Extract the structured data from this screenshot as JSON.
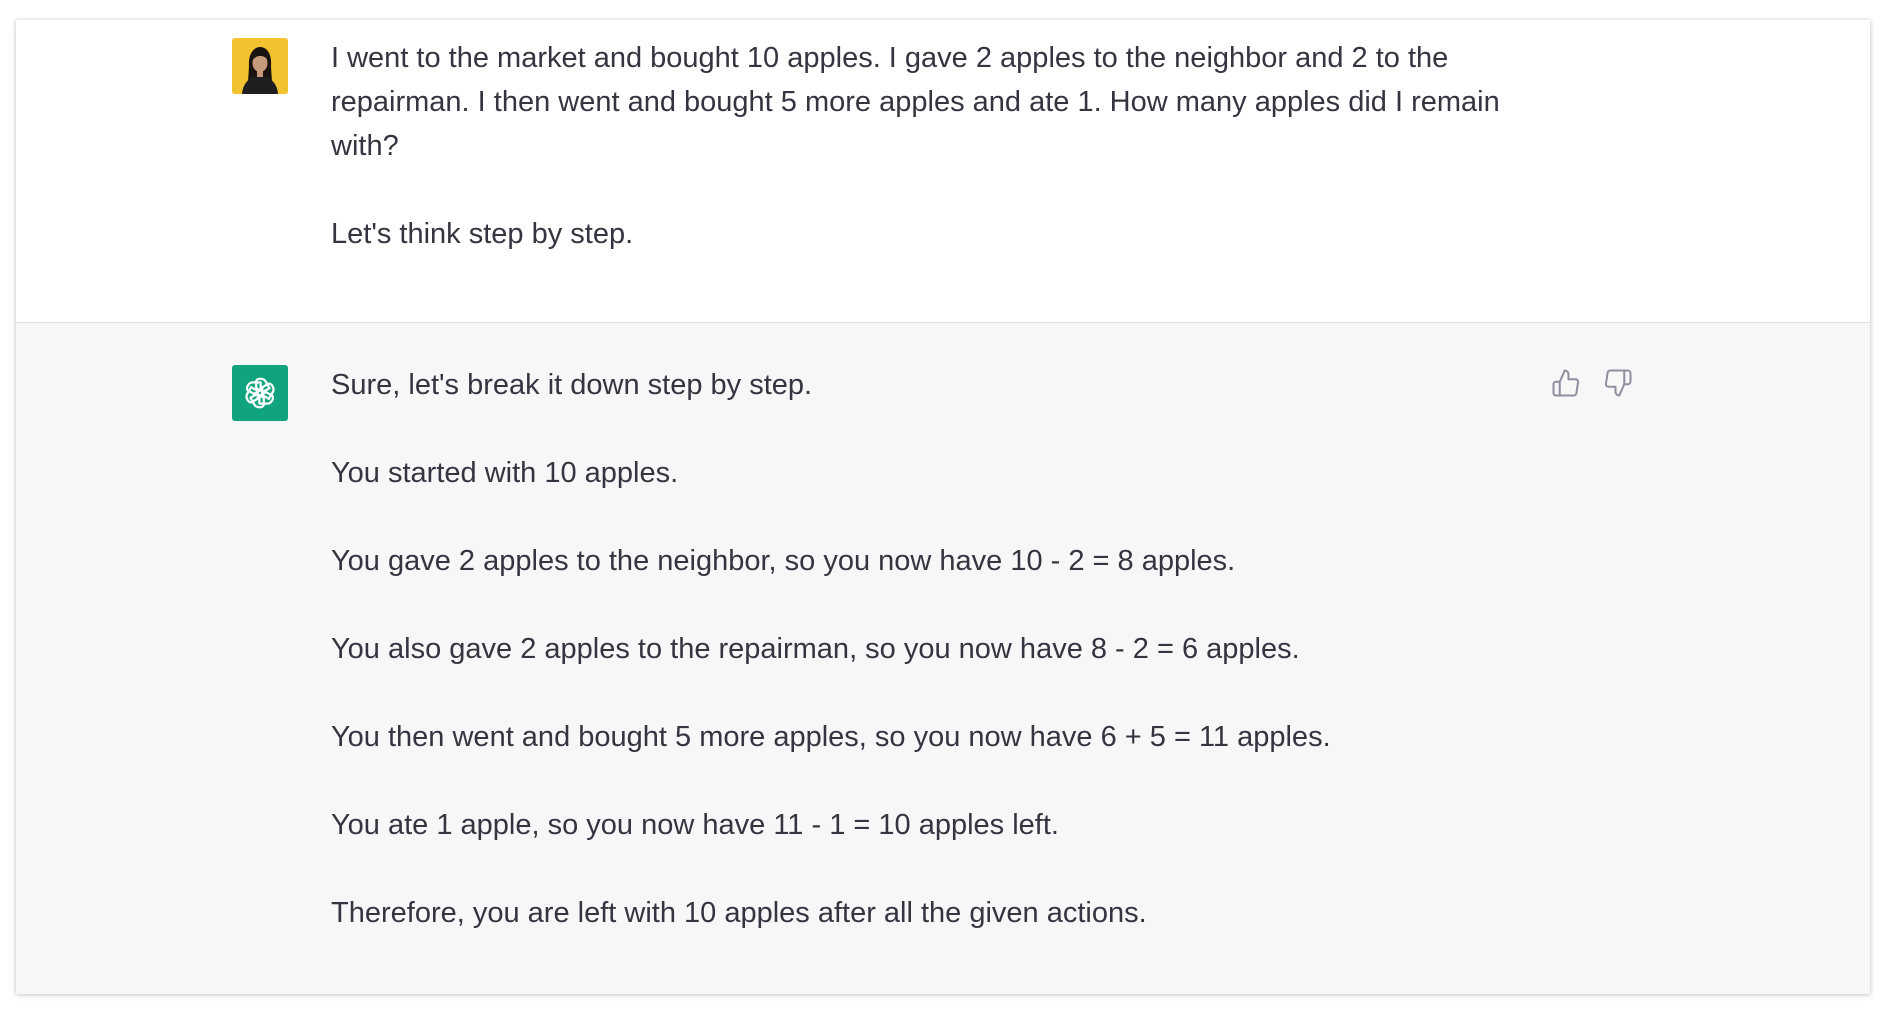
{
  "conversation": {
    "user_message": {
      "lines": [
        "I went to the market and bought 10 apples. I gave 2 apples to the neighbor and 2 to the repairman. I then went and bought 5 more apples and ate 1. How many apples did I remain with?",
        "Let's think step by step."
      ]
    },
    "assistant_message": {
      "paragraphs": [
        "Sure, let's break it down step by step.",
        "You started with 10 apples.",
        "You gave 2 apples to the neighbor, so you now have 10 - 2 = 8 apples.",
        "You also gave 2 apples to the repairman, so you now have 8 - 2 = 6 apples.",
        "You then went and bought 5 more apples, so you now have 6 + 5 = 11 apples.",
        "You ate 1 apple, so you now have 11 - 1 = 10 apples left.",
        "Therefore, you are left with 10 apples after all the given actions."
      ]
    },
    "feedback": {
      "thumbs_up_icon": "thumbs-up-icon",
      "thumbs_down_icon": "thumbs-down-icon"
    }
  },
  "colors": {
    "assistant_avatar_bg": "#10a37f",
    "user_avatar_bg": "#f2c230",
    "assistant_row_bg": "#f7f7f8",
    "text": "#343541",
    "icon": "#8e8ea0"
  }
}
